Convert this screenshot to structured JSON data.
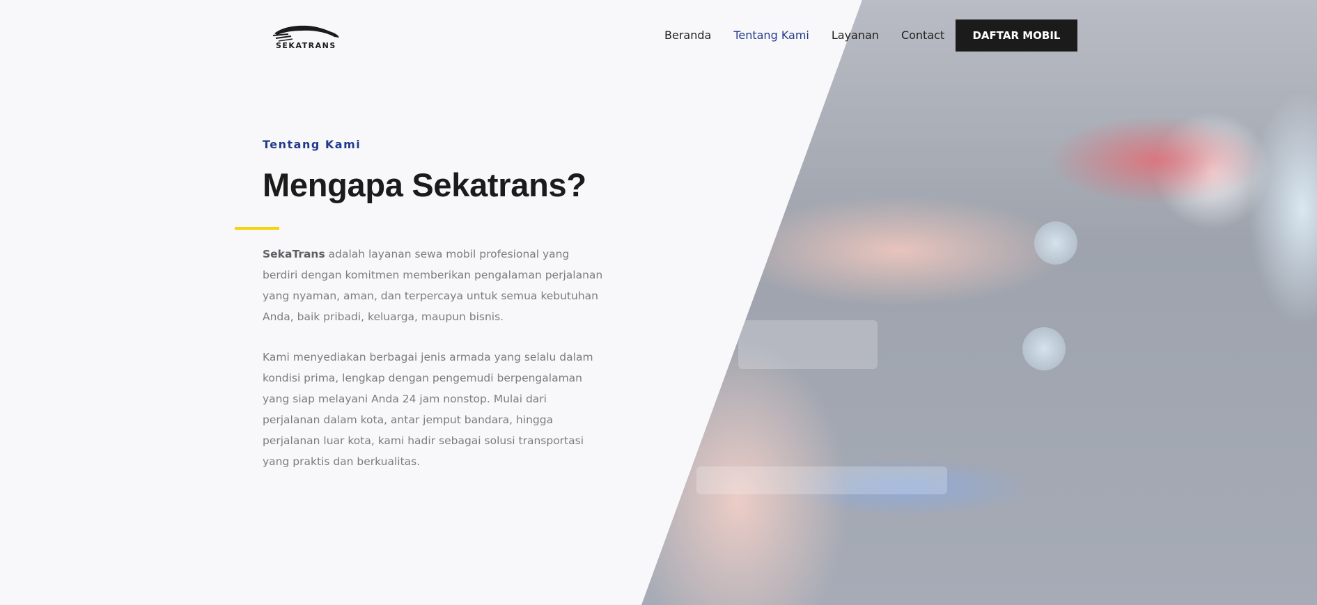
{
  "header": {
    "logo_text": "SEKATRANS",
    "nav": [
      {
        "label": "Beranda",
        "active": false
      },
      {
        "label": "Tentang Kami",
        "active": true
      },
      {
        "label": "Layanan",
        "active": false
      },
      {
        "label": "Contact",
        "active": false
      }
    ],
    "cta_label": "DAFTAR MOBIL"
  },
  "about": {
    "eyebrow": "Tentang Kami",
    "title": "Mengapa Sekatrans?",
    "para1_brand": "SekaTrans",
    "para1_rest": " adalah layanan sewa mobil profesional yang berdiri dengan komitmen memberikan pengalaman perjalanan yang nyaman, aman, dan terpercaya untuk semua kebutuhan Anda, baik pribadi, keluarga, maupun bisnis.",
    "para2": "Kami menyediakan berbagai jenis armada yang selalu dalam kondisi prima, lengkap dengan pengemudi berpengalaman yang siap melayani Anda 24 jam nonstop. Mulai dari perjalanan dalam kota, antar jemput bandara, hingga perjalanan luar kota, kami hadir sebagai solusi transportasi yang praktis dan berkualitas."
  },
  "colors": {
    "accent_blue": "#223a8c",
    "accent_yellow": "#f5d30f",
    "cta_bg": "#1b1b1b",
    "page_bg": "#f8f8fa"
  },
  "icons": {
    "logo": "car-silhouette-icon"
  }
}
